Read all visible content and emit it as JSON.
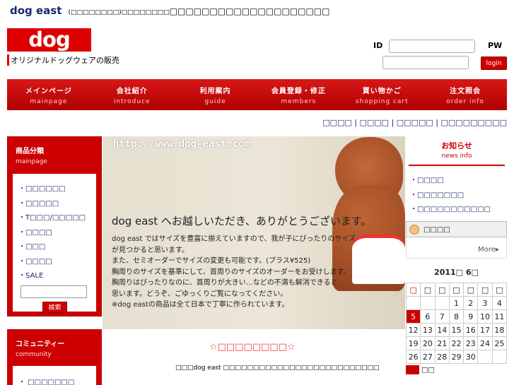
{
  "site": {
    "title": "dog east",
    "title_sub": "(□□□□□□□□)□□□□□□□□",
    "title_sub2": "□□□□□□□□□□□□□□□□□□□□"
  },
  "logo": {
    "text": "dog east",
    "tagline": "オリジナルドッグウェアの販売"
  },
  "login": {
    "id_label": "ID",
    "pw_label": "PW",
    "button": "login"
  },
  "nav": [
    {
      "jp": "メインページ",
      "en": "mainpage"
    },
    {
      "jp": "会社紹介",
      "en": "introduce"
    },
    {
      "jp": "利用案内",
      "en": "guide"
    },
    {
      "jp": "会員登録・修正",
      "en": "members"
    },
    {
      "jp": "買い物かご",
      "en": "shopping cart"
    },
    {
      "jp": "注文照会",
      "en": "order info"
    }
  ],
  "util_links": [
    "□□□□",
    "□□□□",
    "□□□□□",
    "□□□□□□□□□"
  ],
  "category": {
    "heading": "商品分類",
    "heading_en": "mainpage",
    "items": [
      "・□□□□□□",
      "・□□□□□",
      "・T□□□/□□□□□",
      "・□□□□",
      "・□□□",
      "・□□□□",
      "・SALE"
    ],
    "search_button": "検索"
  },
  "community": {
    "heading": "コミュニティー",
    "heading_en": "community",
    "first_item": "・ □□□□□□□"
  },
  "banner": {
    "url": "http://www.dog-east.com",
    "welcome_heading": "dog east へお越しいただき、ありがとうございます。",
    "welcome_lines": [
      "dog east ではサイズを豊富に揃えていますので、我が子にぴったりのサイズ",
      "が見つかると思います。",
      "また、セミオーダーでサイズの変更も可能です。(プラス¥525)",
      "胸周りのサイズを基準にして、首周りのサイズのオーダーをお受けします。",
      "胸周りはぴったりなのに、首周りが大きい…などの不満も解消できると",
      "思います。どうぞ、ごゆっくりご覧になってください。",
      "※dog eastの商品は全て日本で丁寧に作られています。"
    ]
  },
  "shop": {
    "heading": "☆□□□□□□□□☆",
    "desc": "□□□dog east □□□□□□□□□□□□□□□□□□□□□□□□□□"
  },
  "news": {
    "heading": "お知らせ",
    "heading_en": "news info",
    "items": [
      "・□□□□",
      "・□□□□□□□",
      "・□□□□□□□□□□□"
    ],
    "notice_label": "□□□□",
    "more": "More▸"
  },
  "calendar": {
    "title": "2011□ 6□",
    "weekdays": [
      "□",
      "□",
      "□",
      "□",
      "□",
      "□",
      "□"
    ],
    "weeks": [
      [
        "",
        "",
        "",
        "1",
        "2",
        "3",
        "4"
      ],
      [
        "5",
        "6",
        "7",
        "8",
        "9",
        "10",
        "11"
      ],
      [
        "12",
        "13",
        "14",
        "15",
        "16",
        "17",
        "18"
      ],
      [
        "19",
        "20",
        "21",
        "22",
        "23",
        "24",
        "25"
      ],
      [
        "26",
        "27",
        "28",
        "29",
        "30",
        "",
        ""
      ]
    ],
    "legend": "□□",
    "accent": "#cc0000"
  }
}
